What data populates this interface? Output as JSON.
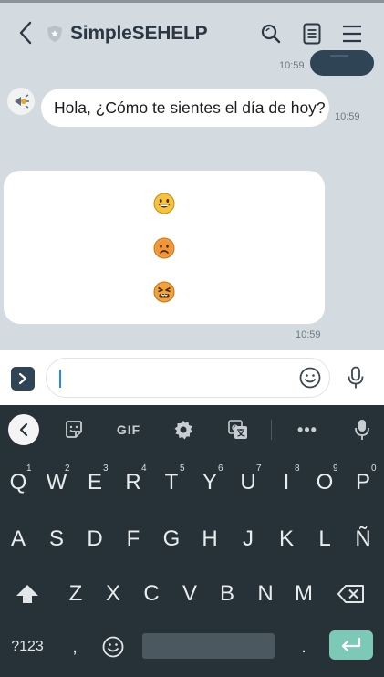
{
  "header": {
    "title": "SimpleSEHELP",
    "icons": [
      "back-arrow-icon",
      "shield-badge-icon",
      "search-icon",
      "notes-icon",
      "menu-icon"
    ]
  },
  "chat": {
    "previous_message_time": "10:59",
    "incoming_message": "Hola, ¿Cómo te sientes el día de hoy?",
    "incoming_time": "10:59",
    "emoji_card_time": "10:59",
    "emoji_options": [
      "😀",
      "☹️",
      "😖"
    ]
  },
  "composer": {
    "input_value": "",
    "icons": [
      "expand-icon",
      "smiley-icon",
      "microphone-icon"
    ]
  },
  "keyboard": {
    "toolbar": {
      "gif_label": "GIF",
      "more_label": "•••"
    },
    "row1": [
      {
        "k": "Q",
        "h": "1"
      },
      {
        "k": "W",
        "h": "2"
      },
      {
        "k": "E",
        "h": "3"
      },
      {
        "k": "R",
        "h": "4"
      },
      {
        "k": "T",
        "h": "5"
      },
      {
        "k": "Y",
        "h": "6"
      },
      {
        "k": "U",
        "h": "7"
      },
      {
        "k": "I",
        "h": "8"
      },
      {
        "k": "O",
        "h": "9"
      },
      {
        "k": "P",
        "h": "0"
      }
    ],
    "row2": [
      "A",
      "S",
      "D",
      "F",
      "G",
      "H",
      "J",
      "K",
      "L",
      "Ñ"
    ],
    "row3": [
      "Z",
      "X",
      "C",
      "V",
      "B",
      "N",
      "M"
    ],
    "symbols_label": "?123",
    "comma_label": ",",
    "period_label": "."
  },
  "colors": {
    "chat_background": "#d3dae0",
    "keyboard_background": "#263238",
    "accent_dark": "#2f4454",
    "enter_key": "#7dc9b8"
  }
}
